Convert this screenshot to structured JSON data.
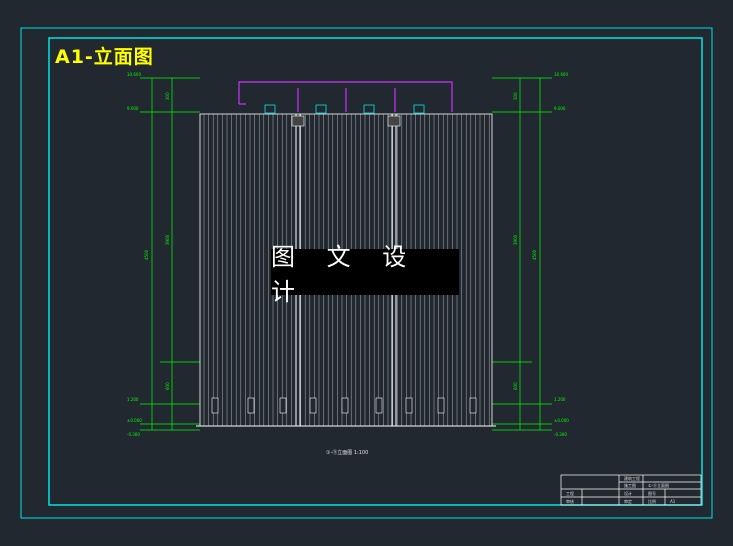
{
  "drawing": {
    "title": "A1-立面图",
    "watermark": "图 文 设 计",
    "caption": "①-⑪立面图  1:100"
  },
  "colors": {
    "background": "#212830",
    "frame": "#00e5e5",
    "dimension": "#00ff00",
    "facade": "#ffffff",
    "roof_parapet": "#cc33ff",
    "title_text": "#ffff00"
  },
  "elevation_marks": {
    "left_top": "10.600",
    "left_roof": "9.000",
    "left_low": "1.200",
    "left_ground": "±0.000",
    "left_base": "-0.300",
    "right_top": "10.600",
    "right_roof": "9.000",
    "right_low": "1.200",
    "right_ground": "±0.000",
    "right_base": "-0.300"
  },
  "title_block": {
    "row1_right": "建筑工程",
    "row2_left": "施工图",
    "row2_right": "①-⑪立面图",
    "row3_a": "工程",
    "row3_b": "设计",
    "row3_c": "图号",
    "row4_a": "审核",
    "row4_b": "审定",
    "row4_c": "比例",
    "row4_d": "A1"
  }
}
